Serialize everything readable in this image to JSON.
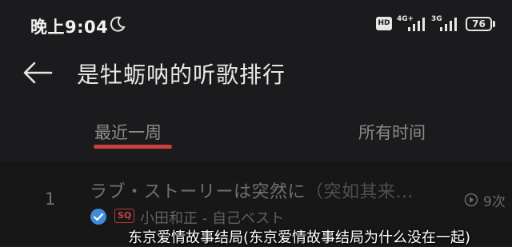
{
  "status_bar": {
    "time": "晚上9:04",
    "hd_label": "HD",
    "network1": "4G+",
    "network2": "3G",
    "battery": "76"
  },
  "header": {
    "title": "是牡蛎呐的听歌排行"
  },
  "tabs": [
    {
      "label": "最近一周",
      "active": true
    },
    {
      "label": "所有时间",
      "active": false
    }
  ],
  "songs": [
    {
      "rank": "1",
      "title": "ラブ・ストーリーは突然に",
      "alias": "（突如其来…",
      "badge": "SQ",
      "artist": "小田和正 - 自己ベスト",
      "play_count": "9次"
    }
  ],
  "caption": "东京爱情故事结局(东京爱情故事结局为什么没在一起)",
  "colors": {
    "background": "#1b1b1d",
    "accent": "#c9413a",
    "verified": "#3d8bd9"
  }
}
